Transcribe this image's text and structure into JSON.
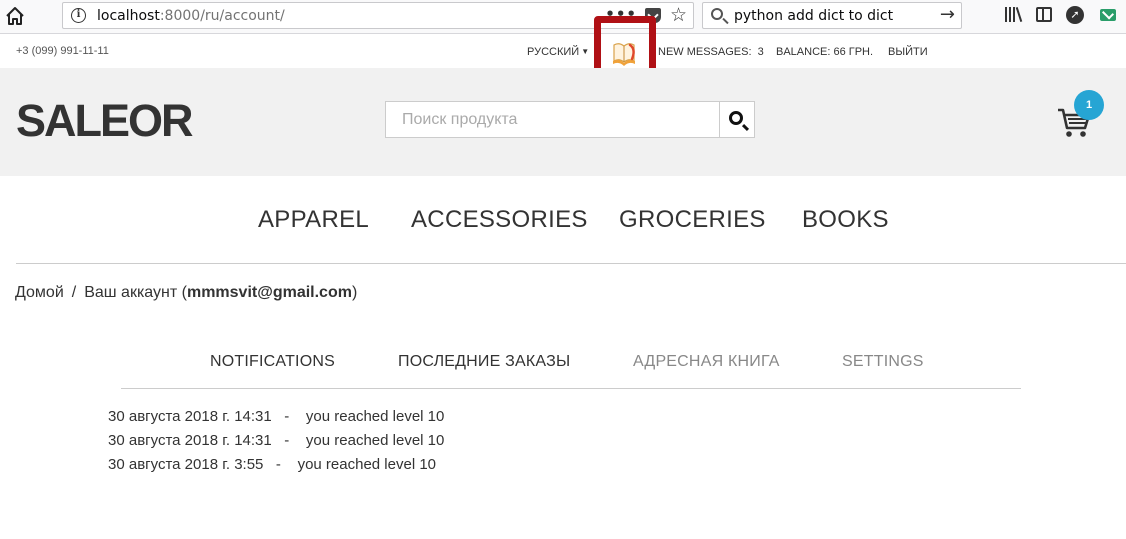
{
  "browser": {
    "url_host": "localhost",
    "url_path": ":8000/ru/account/",
    "search_query": "python add dict to dict"
  },
  "topbar": {
    "phone": "+3 (099) 991-11-11",
    "language": "РУССКИЙ",
    "new_messages_label": "NEW MESSAGES:",
    "new_messages_count": "3",
    "balance": "BALANCE: 66 ГРН.",
    "logout": "ВЫЙТИ"
  },
  "header": {
    "logo": "SALEOR",
    "search_placeholder": "Поиск продукта",
    "cart_count": "1"
  },
  "categories": [
    "APPAREL",
    "ACCESSORIES",
    "GROCERIES",
    "BOOKS"
  ],
  "breadcrumb": {
    "home": "Домой",
    "separator": "/",
    "account_label": "Ваш аккаунт (",
    "email": "mmmsvit@gmail.com",
    "close_paren": ")"
  },
  "tabs": [
    "NOTIFICATIONS",
    "ПОСЛЕДНИЕ ЗАКАЗЫ",
    "АДРЕСНАЯ КНИГА",
    "SETTINGS"
  ],
  "notifications": [
    {
      "date": "30 августа 2018 г. 14:31",
      "separator": "-",
      "message": "you reached level 10"
    },
    {
      "date": "30 августа 2018 г. 14:31",
      "separator": "-",
      "message": "you reached level 10"
    },
    {
      "date": "30 августа 2018 г. 3:55",
      "separator": "-",
      "message": "you reached level 10"
    }
  ],
  "colors": {
    "highlight_border": "#b01015",
    "cart_badge": "#26a5d4",
    "header_bg": "#f1f1f1"
  },
  "icons": [
    "home-icon",
    "info-icon",
    "page-actions-icon",
    "pocket-icon",
    "bookmark-star-icon",
    "search-icon",
    "search-go-arrow-icon",
    "library-icon",
    "sidebar-icon",
    "extension-icon",
    "mail-extension-icon",
    "book-icon",
    "dropdown-caret-icon",
    "search-icon",
    "cart-icon"
  ]
}
